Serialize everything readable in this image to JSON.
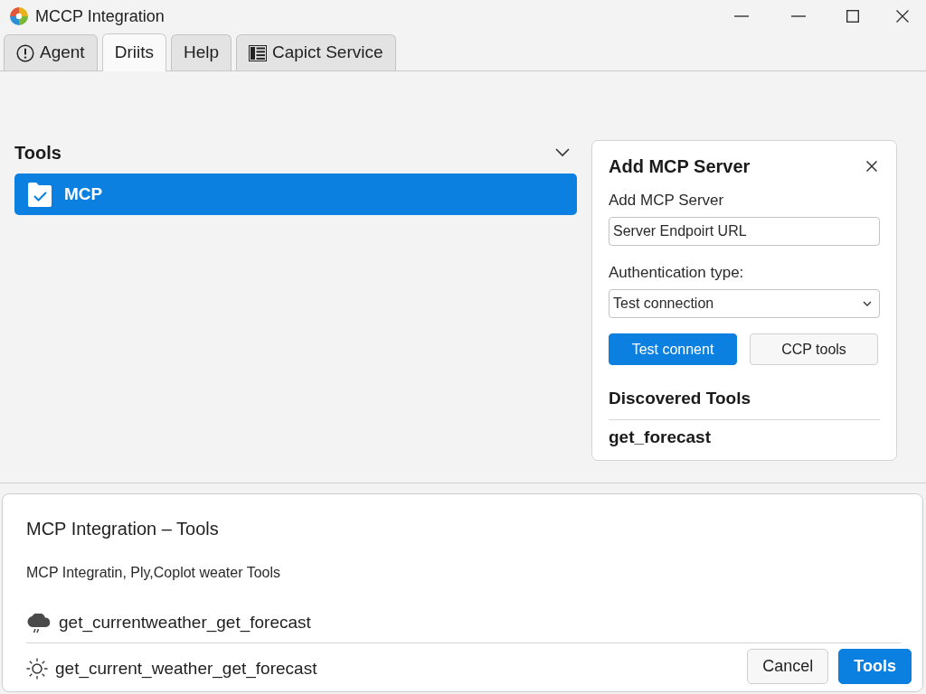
{
  "window": {
    "title": "MCCP Integration"
  },
  "tabs": [
    {
      "label": "Agent",
      "selected": false
    },
    {
      "label": "Driits",
      "selected": true
    },
    {
      "label": "Help",
      "selected": false
    },
    {
      "label": "Capict Service",
      "selected": false
    }
  ],
  "sidebar": {
    "heading": "Tools",
    "expanded": true,
    "items": [
      {
        "label": "MCP",
        "selected": true
      }
    ]
  },
  "server_panel": {
    "title": "Add MCP Server",
    "url_label": "Add MCP Server",
    "url_field": {
      "value": "Server Endpoirt URL"
    },
    "auth_label": "Authentication type:",
    "auth_select": {
      "value": "Test connection"
    },
    "buttons": [
      {
        "label": "Test connent",
        "kind": "primary"
      },
      {
        "label": "CCP tools",
        "kind": "secondary"
      }
    ],
    "discovered_heading": "Discovered Tools",
    "discovered_tools": [
      "get_forecast"
    ]
  },
  "bottom_panel": {
    "title": "MCP Integration – Tools",
    "subtitle": "MCP Integratin, Ply,Coplot weater Tools",
    "tools": [
      {
        "name": "get_currentweather_get_forecast"
      },
      {
        "name": "get_current_weather_get_forecast"
      }
    ],
    "buttons": [
      {
        "label": "Cancel",
        "kind": "secondary"
      },
      {
        "label": "Tools",
        "kind": "primary"
      }
    ]
  }
}
